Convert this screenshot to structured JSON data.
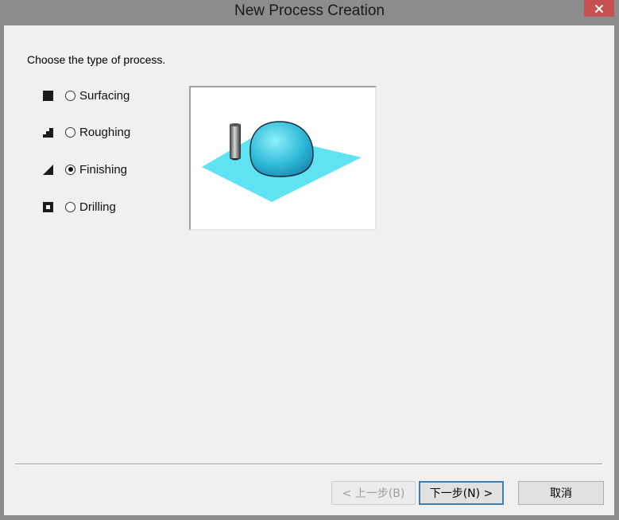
{
  "window": {
    "title": "New Process Creation"
  },
  "prompt": "Choose the type of process.",
  "process_types": [
    {
      "label": "Surfacing",
      "icon": "filled-square-icon",
      "checked": false
    },
    {
      "label": "Roughing",
      "icon": "stairs-icon",
      "checked": false
    },
    {
      "label": "Finishing",
      "icon": "triangle-slope-icon",
      "checked": true
    },
    {
      "label": "Drilling",
      "icon": "hole-square-icon",
      "checked": false
    }
  ],
  "buttons": {
    "back": "< 上一步(B)",
    "next": "下一步(N) >",
    "cancel": "取消"
  },
  "colors": {
    "close_button": "#c75050",
    "default_button_border": "#3c7fb1",
    "preview_plane": "#5ee3f2",
    "preview_dome": "#2fb9d8"
  }
}
